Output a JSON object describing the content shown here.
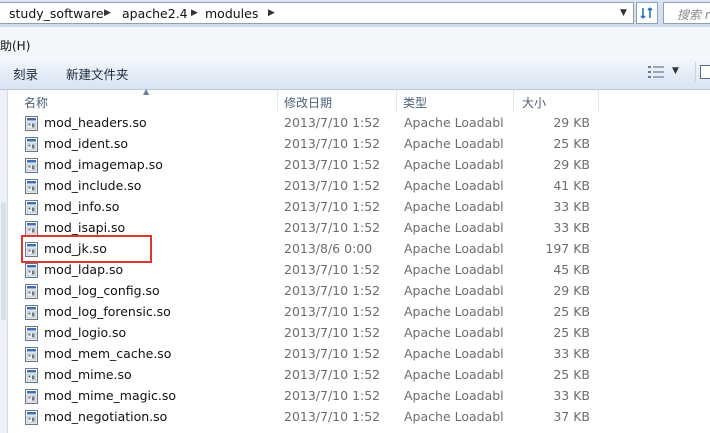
{
  "address": {
    "crumbs": [
      "study_software",
      "apache2.4",
      "modules"
    ],
    "search_placeholder": "搜索 r"
  },
  "menu": {
    "partial_item": "助(H)"
  },
  "toolbar": {
    "burn": "刻录",
    "new_folder": "新建文件夹"
  },
  "columns": {
    "name": "名称",
    "date": "修改日期",
    "type": "类型",
    "size": "大小"
  },
  "files": [
    {
      "name": "mod_headers.so",
      "date": "2013/7/10 1:52",
      "type": "Apache Loadabl",
      "size": "29 KB"
    },
    {
      "name": "mod_ident.so",
      "date": "2013/7/10 1:52",
      "type": "Apache Loadabl",
      "size": "25 KB"
    },
    {
      "name": "mod_imagemap.so",
      "date": "2013/7/10 1:52",
      "type": "Apache Loadabl",
      "size": "29 KB"
    },
    {
      "name": "mod_include.so",
      "date": "2013/7/10 1:52",
      "type": "Apache Loadabl",
      "size": "41 KB"
    },
    {
      "name": "mod_info.so",
      "date": "2013/7/10 1:52",
      "type": "Apache Loadabl",
      "size": "33 KB"
    },
    {
      "name": "mod_isapi.so",
      "date": "2013/7/10 1:52",
      "type": "Apache Loadabl",
      "size": "33 KB"
    },
    {
      "name": "mod_jk.so",
      "date": "2013/8/6 0:00",
      "type": "Apache Loadabl",
      "size": "197 KB",
      "highlighted": true
    },
    {
      "name": "mod_ldap.so",
      "date": "2013/7/10 1:52",
      "type": "Apache Loadabl",
      "size": "45 KB"
    },
    {
      "name": "mod_log_config.so",
      "date": "2013/7/10 1:52",
      "type": "Apache Loadabl",
      "size": "29 KB"
    },
    {
      "name": "mod_log_forensic.so",
      "date": "2013/7/10 1:52",
      "type": "Apache Loadabl",
      "size": "25 KB"
    },
    {
      "name": "mod_logio.so",
      "date": "2013/7/10 1:52",
      "type": "Apache Loadabl",
      "size": "25 KB"
    },
    {
      "name": "mod_mem_cache.so",
      "date": "2013/7/10 1:52",
      "type": "Apache Loadabl",
      "size": "33 KB"
    },
    {
      "name": "mod_mime.so",
      "date": "2013/7/10 1:52",
      "type": "Apache Loadabl",
      "size": "25 KB"
    },
    {
      "name": "mod_mime_magic.so",
      "date": "2013/7/10 1:52",
      "type": "Apache Loadabl",
      "size": "33 KB"
    },
    {
      "name": "mod_negotiation.so",
      "date": "2013/7/10 1:52",
      "type": "Apache Loadabl",
      "size": "37 KB"
    }
  ],
  "colors": {
    "highlight_box": "#e0352f",
    "header_text": "#4c607a"
  },
  "icons": [
    "chevron-right-icon",
    "dropdown-arrow-icon",
    "refresh-icon",
    "view-options-icon",
    "preview-pane-icon",
    "dll-file-icon",
    "sort-ascending-icon"
  ]
}
